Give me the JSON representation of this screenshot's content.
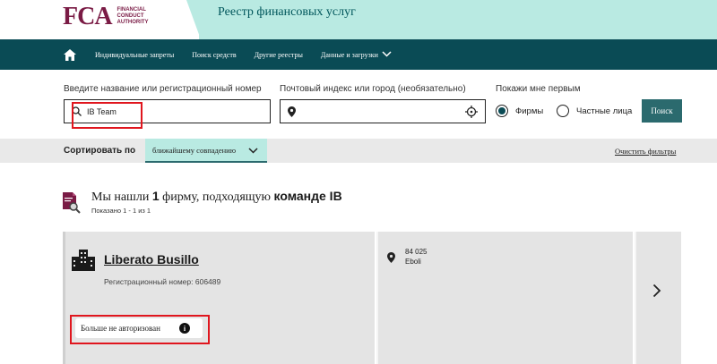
{
  "header": {
    "logo_mark": "FCA",
    "logo_text_line1": "FINANCIAL",
    "logo_text_line2": "CONDUCT",
    "logo_text_line3": "AUTHORITY",
    "site_title": "Реестр финансовых услуг"
  },
  "nav": {
    "home_icon": "home-icon",
    "items": [
      {
        "label": "Индивидуальные запреты"
      },
      {
        "label": "Поиск средств"
      },
      {
        "label": "Другие реестры"
      },
      {
        "label": "Данные и загрузки"
      }
    ]
  },
  "search": {
    "name_label": "Введите название или регистрационный номер",
    "name_value": "IB Team",
    "location_label": "Почтовый индекс или город (необязательно)",
    "location_value": "",
    "show_first_label": "Покажи мне первым",
    "option_firms": "Фирмы",
    "option_individuals": "Частные лица",
    "selected_option": "Фирмы",
    "search_button": "Поиск"
  },
  "sort": {
    "label": "Сортировать по",
    "selected": "ближайшему совпадению",
    "clear_filters": "Очистить фильтры"
  },
  "results": {
    "title_prefix": "Мы нашли ",
    "title_count": "1",
    "title_middle": " фирму, подходящую ",
    "title_query": "команде IB",
    "shown": "Показано 1 - 1 из 1",
    "items": [
      {
        "name": "Liberato Busillo",
        "reg_no": "Регистрационный номер: 606489",
        "status": "Больше не авторизован",
        "address_line1": "84 025",
        "address_line2": "Eboli"
      }
    ]
  },
  "colors": {
    "brand": "#7a1b45",
    "nav_bg": "#0a4b55",
    "accent_teal": "#b9eae2",
    "button": "#2b6a6e",
    "highlight_red": "#e0161e"
  }
}
